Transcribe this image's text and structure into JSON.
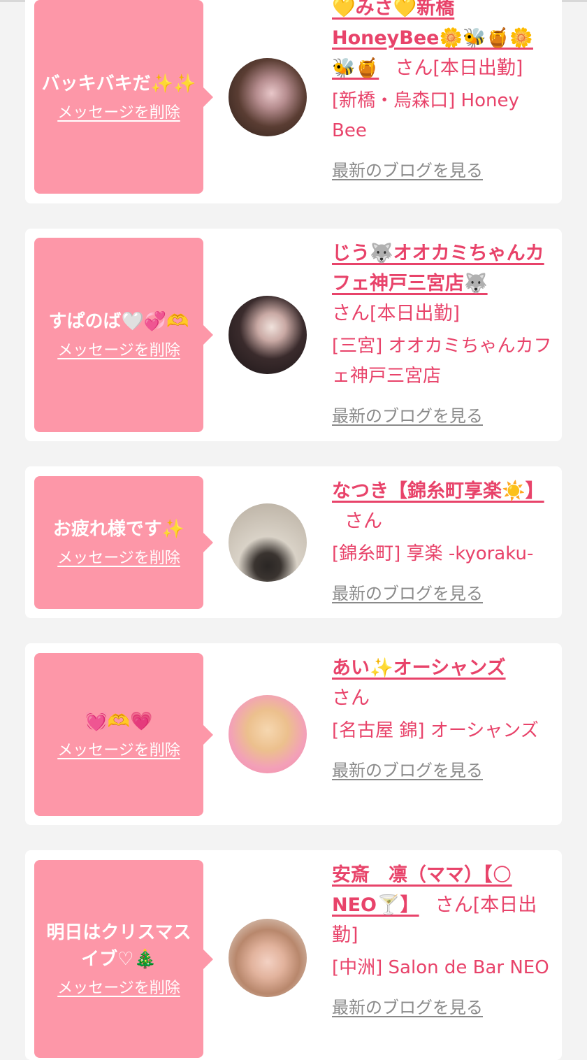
{
  "common": {
    "delete_label": "メッセージを削除",
    "blog_label": "最新のブログを見る",
    "san": "さん"
  },
  "messages": [
    {
      "message": "バッキバキだ✨✨",
      "name": "💛みさ💛新橋HoneyBee🌼🐝🍯🌼🐝🍯",
      "status": "[本日出勤]",
      "shop": "[新橋・烏森口] Honey Bee"
    },
    {
      "message": "すぱのば🤍💞🫶",
      "name": "じう🐺オオカミちゃんカフェ神戸三宮店🐺",
      "status": "[本日出勤]",
      "shop": "[三宮] オオカミちゃんカフェ神戸三宮店"
    },
    {
      "message": "お疲れ様です✨",
      "name": "なつき【錦糸町享楽☀️】",
      "status": "",
      "shop": "[錦糸町] 享楽 -kyoraku-"
    },
    {
      "message": "💓🫶💗",
      "name": "あい✨オーシャンズ",
      "status": "",
      "shop": "[名古屋 錦] オーシャンズ"
    },
    {
      "message": "明日はクリスマスイブ♡🎄",
      "name": "安斎　凛（ママ）【🌕NEO🍸】",
      "status": "[本日出勤]",
      "shop": "[中洲] Salon de Bar NEO"
    }
  ]
}
